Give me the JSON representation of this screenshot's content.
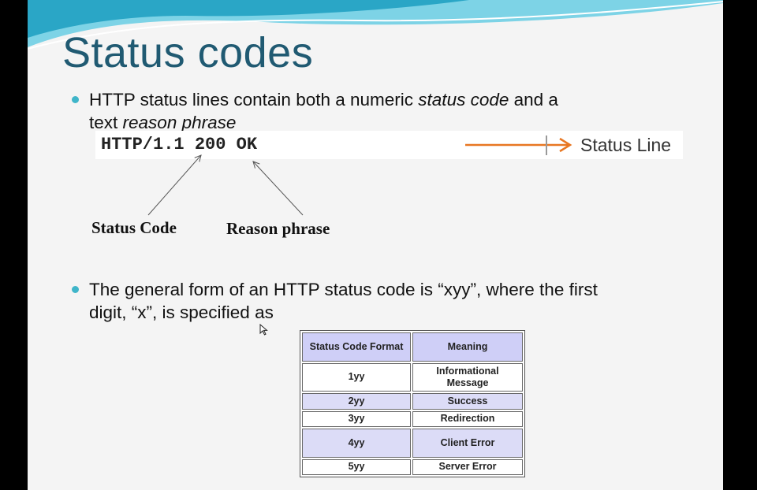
{
  "slide": {
    "title": "Status codes",
    "bullet1": {
      "part1": "HTTP status lines contain both a numeric ",
      "em1": "status code",
      "part2": " and a",
      "line2": "text ",
      "em2": "reason phrase"
    },
    "diagram": {
      "status_line": "HTTP/1.1 200 OK",
      "status_line_label": "Status Line",
      "status_code_label": "Status Code",
      "reason_phrase_label": "Reason phrase"
    },
    "bullet2": {
      "line1": "The general form of an HTTP status code is “xyy”, where the first",
      "line2": "digit, “x”, is specified as"
    },
    "table": {
      "headers": [
        "Status Code Format",
        "Meaning"
      ],
      "rows": [
        {
          "format": "1yy",
          "meaning": "Informational Message"
        },
        {
          "format": "2yy",
          "meaning": "Success"
        },
        {
          "format": "3yy",
          "meaning": "Redirection"
        },
        {
          "format": "4yy",
          "meaning": "Client Error"
        },
        {
          "format": "5yy",
          "meaning": "Server Error"
        }
      ]
    }
  },
  "colors": {
    "title": "#205a72",
    "bullet": "#3fb5c9",
    "arrow": "#e87722",
    "table_header": "#cfcff7",
    "table_shade": "#dcdcf7"
  }
}
